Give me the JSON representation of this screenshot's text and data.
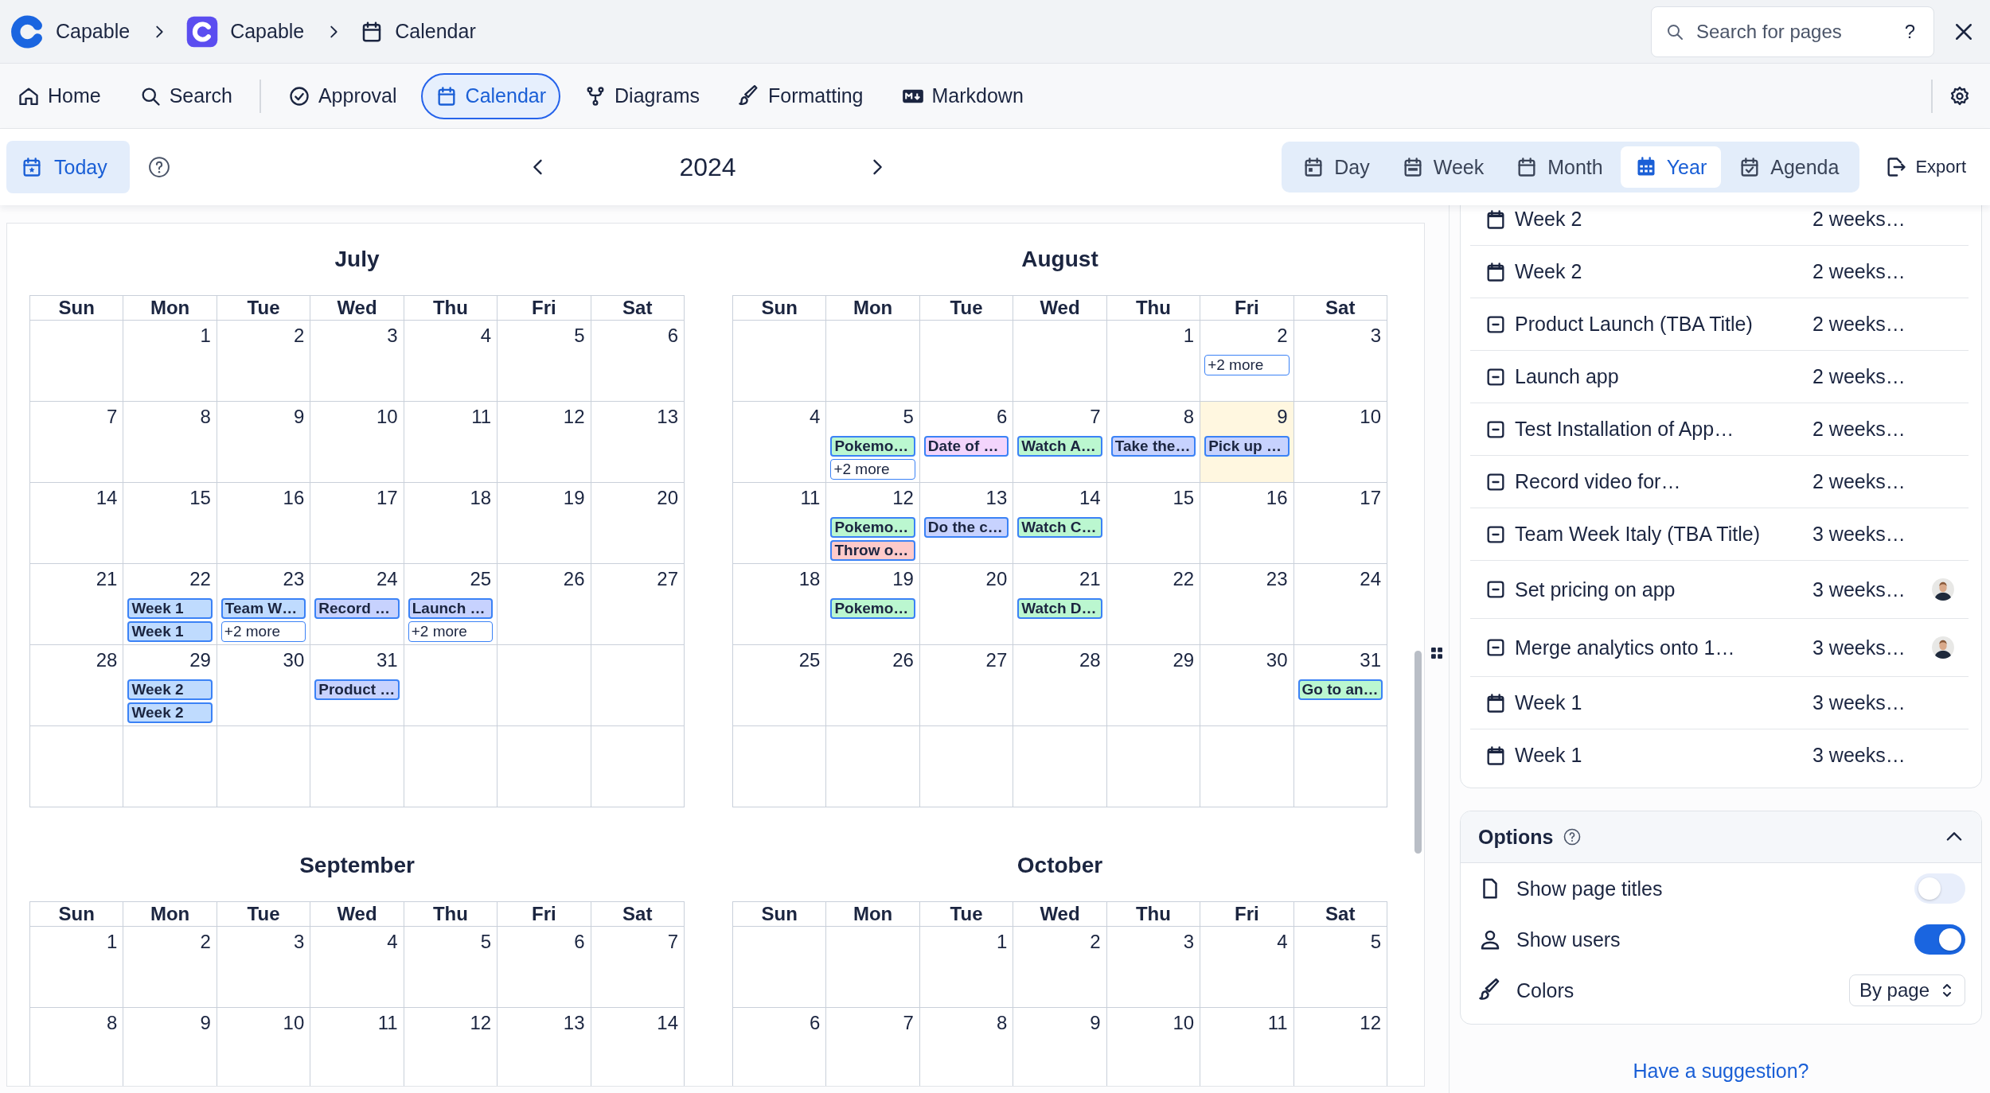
{
  "breadcrumbs": [
    {
      "label": "Capable"
    },
    {
      "label": "Capable"
    },
    {
      "label": "Calendar"
    }
  ],
  "search": {
    "placeholder": "Search for pages",
    "shortcut": "?"
  },
  "toolbar": {
    "groups": [
      [
        {
          "label": "Home",
          "selected": false
        },
        {
          "label": "Search",
          "selected": false
        }
      ],
      [
        {
          "label": "Approval",
          "selected": false
        },
        {
          "label": "Calendar",
          "selected": true
        },
        {
          "label": "Diagrams",
          "selected": false
        },
        {
          "label": "Formatting",
          "selected": false
        },
        {
          "label": "Markdown",
          "selected": false
        }
      ]
    ]
  },
  "calendar_header": {
    "today_button": "Today",
    "year": "2024",
    "export_button": "Export",
    "views": [
      {
        "label": "Day",
        "selected": false
      },
      {
        "label": "Week",
        "selected": false
      },
      {
        "label": "Month",
        "selected": false
      },
      {
        "label": "Year",
        "selected": true
      },
      {
        "label": "Agenda",
        "selected": false
      }
    ]
  },
  "months": [
    {
      "title": "July",
      "weekdays": [
        "Sun",
        "Mon",
        "Tue",
        "Wed",
        "Thu",
        "Fri",
        "Sat"
      ],
      "weeks": [
        [
          {
            "today": false
          },
          {
            "day": "1",
            "today": false
          },
          {
            "day": "2",
            "today": false
          },
          {
            "day": "3",
            "today": false
          },
          {
            "day": "4",
            "today": false
          },
          {
            "day": "5",
            "today": false
          },
          {
            "day": "6",
            "today": false
          }
        ],
        [
          {
            "day": "7",
            "today": false
          },
          {
            "day": "8",
            "today": false
          },
          {
            "day": "9",
            "today": false
          },
          {
            "day": "10",
            "today": false
          },
          {
            "day": "11",
            "today": false
          },
          {
            "day": "12",
            "today": false
          },
          {
            "day": "13",
            "today": false
          }
        ],
        [
          {
            "day": "14",
            "today": false
          },
          {
            "day": "15",
            "today": false
          },
          {
            "day": "16",
            "today": false
          },
          {
            "day": "17",
            "today": false
          },
          {
            "day": "18",
            "today": false
          },
          {
            "day": "19",
            "today": false
          },
          {
            "day": "20",
            "today": false
          }
        ],
        [
          {
            "day": "21",
            "today": false
          },
          {
            "day": "22",
            "today": false,
            "events": [
              {
                "title": "Week 1",
                "color": "#bfdbfe"
              },
              {
                "title": "Week 1",
                "color": "#bfdbfe"
              }
            ]
          },
          {
            "day": "23",
            "today": false,
            "events": [
              {
                "title": "Team W…",
                "color": "#bfdbfe"
              }
            ],
            "more": "+2 more"
          },
          {
            "day": "24",
            "today": false,
            "events": [
              {
                "title": "Record …",
                "color": "#c7d2fe"
              }
            ]
          },
          {
            "day": "25",
            "today": false,
            "events": [
              {
                "title": "Launch …",
                "color": "#c7d2fe"
              }
            ],
            "more": "+2 more"
          },
          {
            "day": "26",
            "today": false
          },
          {
            "day": "27",
            "today": false
          }
        ],
        [
          {
            "day": "28",
            "today": false
          },
          {
            "day": "29",
            "today": false,
            "events": [
              {
                "title": "Week 2",
                "color": "#bfdbfe"
              },
              {
                "title": "Week 2",
                "color": "#bfdbfe"
              }
            ]
          },
          {
            "day": "30",
            "today": false
          },
          {
            "day": "31",
            "today": false,
            "events": [
              {
                "title": "Product …",
                "color": "#c7d2fe"
              }
            ]
          },
          {
            "today": false
          },
          {
            "today": false
          },
          {
            "today": false
          }
        ],
        [
          {
            "today": false
          },
          {
            "today": false
          },
          {
            "today": false
          },
          {
            "today": false
          },
          {
            "today": false
          },
          {
            "today": false
          },
          {
            "today": false
          }
        ]
      ]
    },
    {
      "title": "August",
      "weekdays": [
        "Sun",
        "Mon",
        "Tue",
        "Wed",
        "Thu",
        "Fri",
        "Sat"
      ],
      "weeks": [
        [
          {
            "today": false
          },
          {
            "today": false
          },
          {
            "today": false
          },
          {
            "today": false
          },
          {
            "day": "1",
            "today": false
          },
          {
            "day": "2",
            "today": false,
            "more": "+2 more"
          },
          {
            "day": "3",
            "today": false
          }
        ],
        [
          {
            "day": "4",
            "today": false
          },
          {
            "day": "5",
            "today": false,
            "events": [
              {
                "title": "Pokemo…",
                "color": "#bbf7d0"
              }
            ],
            "more": "+2 more"
          },
          {
            "day": "6",
            "today": false,
            "events": [
              {
                "title": "Date of …",
                "color": "#f3d5fc"
              }
            ]
          },
          {
            "day": "7",
            "today": false,
            "events": [
              {
                "title": "Watch A…",
                "color": "#bbf7d0"
              }
            ]
          },
          {
            "day": "8",
            "today": false,
            "events": [
              {
                "title": "Take the…",
                "color": "#c7d2fe"
              }
            ]
          },
          {
            "day": "9",
            "today": true,
            "events": [
              {
                "title": "Pick up …",
                "color": "#c7d2fe"
              }
            ]
          },
          {
            "day": "10",
            "today": false
          }
        ],
        [
          {
            "day": "11",
            "today": false
          },
          {
            "day": "12",
            "today": false,
            "events": [
              {
                "title": "Pokemo…",
                "color": "#bbf7d0"
              },
              {
                "title": "Throw o…",
                "color": "#fecaca"
              }
            ]
          },
          {
            "day": "13",
            "today": false,
            "events": [
              {
                "title": "Do the c…",
                "color": "#c7d2fe"
              }
            ]
          },
          {
            "day": "14",
            "today": false,
            "events": [
              {
                "title": "Watch C…",
                "color": "#bbf7d0"
              }
            ]
          },
          {
            "day": "15",
            "today": false
          },
          {
            "day": "16",
            "today": false
          },
          {
            "day": "17",
            "today": false
          }
        ],
        [
          {
            "day": "18",
            "today": false
          },
          {
            "day": "19",
            "today": false,
            "events": [
              {
                "title": "Pokemo…",
                "color": "#bbf7d0"
              }
            ]
          },
          {
            "day": "20",
            "today": false
          },
          {
            "day": "21",
            "today": false,
            "events": [
              {
                "title": "Watch D…",
                "color": "#bbf7d0"
              }
            ]
          },
          {
            "day": "22",
            "today": false
          },
          {
            "day": "23",
            "today": false
          },
          {
            "day": "24",
            "today": false
          }
        ],
        [
          {
            "day": "25",
            "today": false
          },
          {
            "day": "26",
            "today": false
          },
          {
            "day": "27",
            "today": false
          },
          {
            "day": "28",
            "today": false
          },
          {
            "day": "29",
            "today": false
          },
          {
            "day": "30",
            "today": false
          },
          {
            "day": "31",
            "today": false,
            "events": [
              {
                "title": "Go to an…",
                "color": "#bbf7d0"
              }
            ]
          }
        ],
        [
          {
            "today": false
          },
          {
            "today": false
          },
          {
            "today": false
          },
          {
            "today": false
          },
          {
            "today": false
          },
          {
            "today": false
          },
          {
            "today": false
          }
        ]
      ]
    },
    {
      "title": "September",
      "weekdays": [
        "Sun",
        "Mon",
        "Tue",
        "Wed",
        "Thu",
        "Fri",
        "Sat"
      ],
      "weeks": [
        [
          {
            "day": "1",
            "today": false
          },
          {
            "day": "2",
            "today": false
          },
          {
            "day": "3",
            "today": false
          },
          {
            "day": "4",
            "today": false
          },
          {
            "day": "5",
            "today": false
          },
          {
            "day": "6",
            "today": false
          },
          {
            "day": "7",
            "today": false
          }
        ],
        [
          {
            "day": "8",
            "today": false
          },
          {
            "day": "9",
            "today": false
          },
          {
            "day": "10",
            "today": false
          },
          {
            "day": "11",
            "today": false
          },
          {
            "day": "12",
            "today": false
          },
          {
            "day": "13",
            "today": false
          },
          {
            "day": "14",
            "today": false
          }
        ]
      ]
    },
    {
      "title": "October",
      "weekdays": [
        "Sun",
        "Mon",
        "Tue",
        "Wed",
        "Thu",
        "Fri",
        "Sat"
      ],
      "weeks": [
        [
          {
            "today": false
          },
          {
            "today": false
          },
          {
            "day": "1",
            "today": false
          },
          {
            "day": "2",
            "today": false
          },
          {
            "day": "3",
            "today": false
          },
          {
            "day": "4",
            "today": false
          },
          {
            "day": "5",
            "today": false
          }
        ],
        [
          {
            "day": "6",
            "today": false
          },
          {
            "day": "7",
            "today": false
          },
          {
            "day": "8",
            "today": false
          },
          {
            "day": "9",
            "today": false
          },
          {
            "day": "10",
            "today": false
          },
          {
            "day": "11",
            "today": false
          },
          {
            "day": "12",
            "today": false
          }
        ]
      ]
    }
  ],
  "upcoming": [
    {
      "kind": "calendar",
      "title": "Week 2",
      "time": "2 weeks…",
      "avatar": false
    },
    {
      "kind": "calendar",
      "title": "Week 2",
      "time": "2 weeks…",
      "avatar": false
    },
    {
      "kind": "page",
      "title": "Product Launch (TBA Title)",
      "time": "2 weeks…",
      "avatar": false
    },
    {
      "kind": "page",
      "title": "Launch app",
      "time": "2 weeks…",
      "avatar": false
    },
    {
      "kind": "page",
      "title": "Test Installation of App…",
      "time": "2 weeks…",
      "avatar": false
    },
    {
      "kind": "page",
      "title": "Record video for…",
      "time": "2 weeks…",
      "avatar": false
    },
    {
      "kind": "page",
      "title": "Team Week Italy (TBA Title)",
      "time": "3 weeks…",
      "avatar": false
    },
    {
      "kind": "page",
      "title": "Set pricing on app",
      "time": "3 weeks…",
      "avatar": true
    },
    {
      "kind": "page",
      "title": "Merge analytics onto 1…",
      "time": "3 weeks…",
      "avatar": true
    },
    {
      "kind": "calendar",
      "title": "Week 1",
      "time": "3 weeks…",
      "avatar": false
    },
    {
      "kind": "calendar",
      "title": "Week 1",
      "time": "3 weeks…",
      "avatar": false
    }
  ],
  "options": {
    "title": "Options",
    "expanded": true,
    "rows": [
      {
        "kind": "toggle",
        "label": "Show page titles",
        "on": false
      },
      {
        "kind": "toggle",
        "label": "Show users",
        "on": true
      },
      {
        "kind": "select",
        "label": "Colors",
        "value": "By page"
      }
    ]
  },
  "suggestion_link": "Have a suggestion?"
}
